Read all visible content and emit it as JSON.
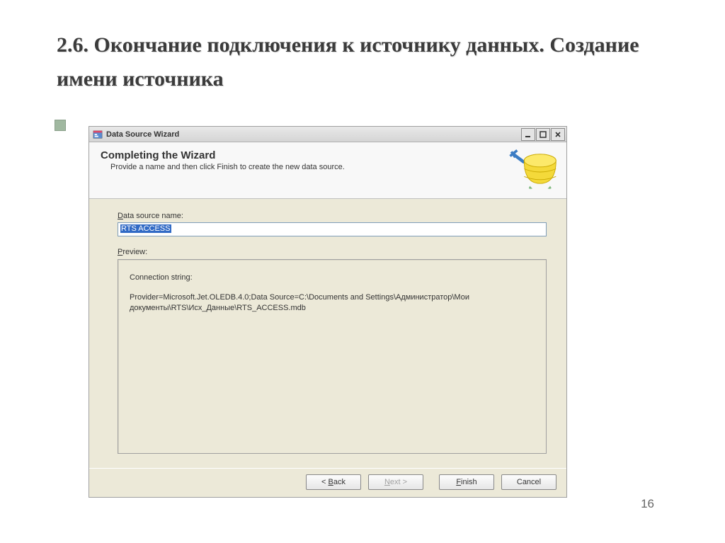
{
  "slide": {
    "title": "2.6. Окончание подключения к источнику данных. Создание имени источника",
    "page_number": "16"
  },
  "window": {
    "title": "Data Source Wizard",
    "header_title": "Completing the Wizard",
    "header_sub": "Provide a name and then click Finish to create the new data source.",
    "labels": {
      "ds_name": "Data source name:",
      "preview": "Preview:"
    },
    "ds_value": "RTS ACCESS",
    "preview": {
      "conn_label": "Connection string:",
      "conn_value": "Provider=Microsoft.Jet.OLEDB.4.0;Data Source=C:\\Documents and Settings\\Администратор\\Мои документы\\RTS\\Исх_Данные\\RTS_ACCESS.mdb"
    },
    "buttons": {
      "back": "< Back",
      "next": "Next >",
      "finish": "Finish",
      "cancel": "Cancel"
    }
  }
}
